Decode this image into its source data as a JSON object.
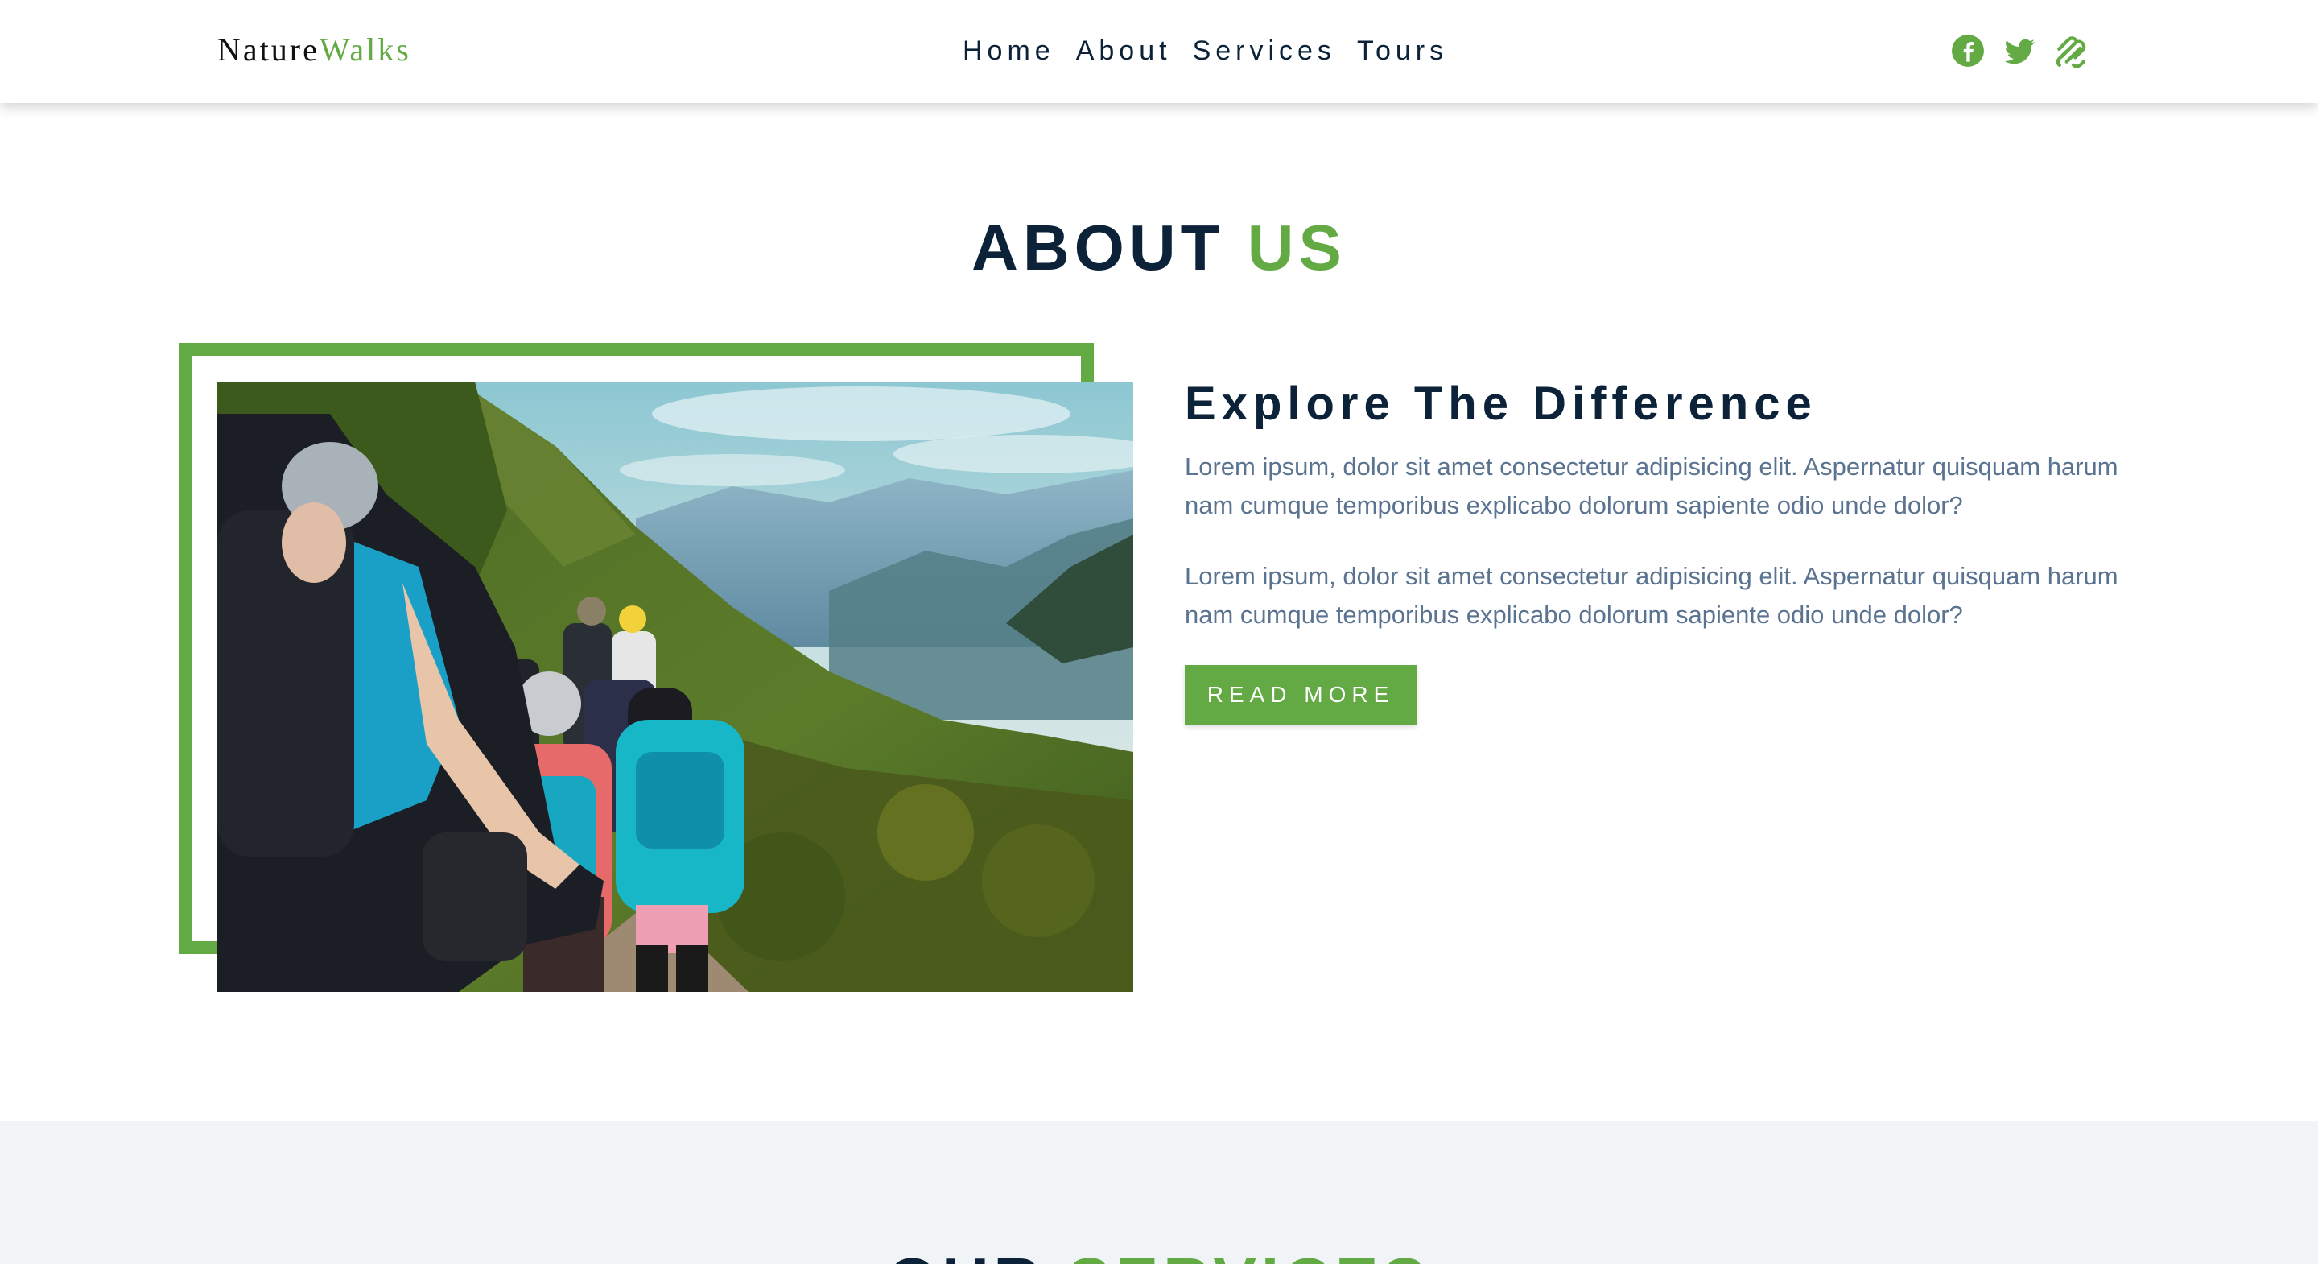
{
  "brand": {
    "part1": "Nature",
    "part2": "Walks"
  },
  "nav": {
    "links": [
      "Home",
      "About",
      "Services",
      "Tours"
    ]
  },
  "social": [
    "facebook-icon",
    "twitter-icon",
    "squarespace-icon"
  ],
  "about": {
    "title_main": "ABOUT",
    "title_accent": "US",
    "heading": "Explore The Difference",
    "paragraphs": [
      "Lorem ipsum, dolor sit amet consectetur adipisicing elit. Aspernatur quisquam harum nam cumque temporibus explicabo dolorum sapiente odio unde dolor?",
      "Lorem ipsum, dolor sit amet consectetur adipisicing elit. Aspernatur quisquam harum nam cumque temporibus explicabo dolorum sapiente odio unde dolor?"
    ],
    "button": "READ MORE"
  },
  "services": {
    "title_main": "OUR",
    "title_accent": "SERVICES"
  },
  "colors": {
    "accent": "#63aa44",
    "dark": "#0b2239",
    "muted": "#5a7390",
    "section_bg": "#f1f4f7"
  }
}
